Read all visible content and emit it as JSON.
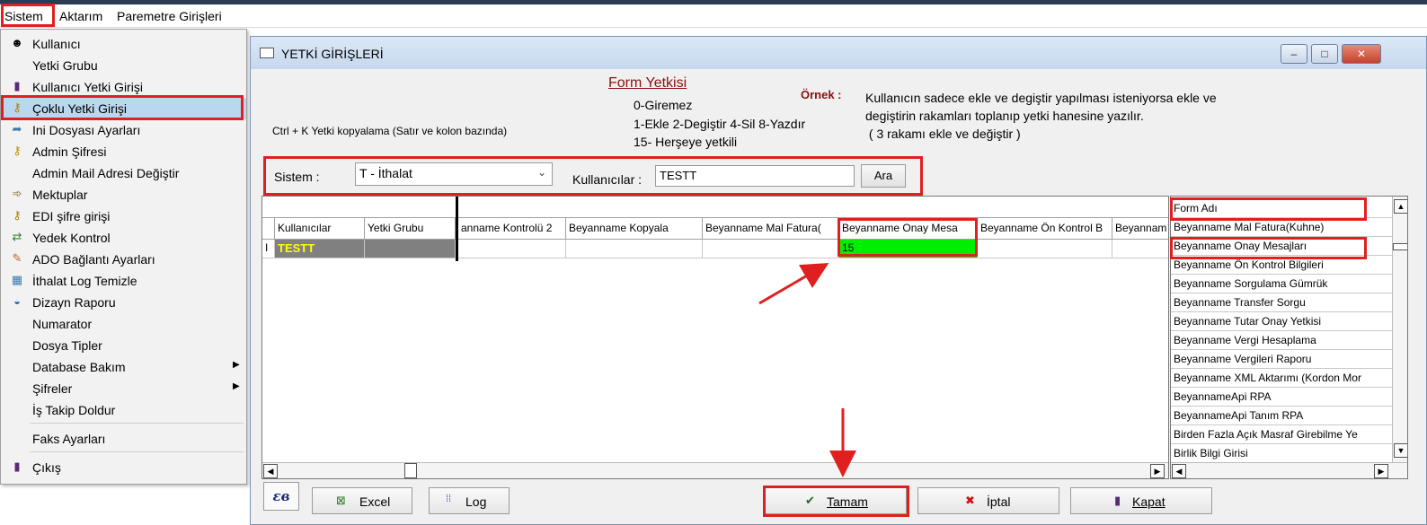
{
  "menubar": {
    "items": [
      "Sistem",
      "Aktarım",
      "Paremetre Girişleri"
    ]
  },
  "sistem_menu": {
    "items": [
      {
        "label": "Kullanıcı",
        "icon": "user-icon"
      },
      {
        "label": "Yetki Grubu",
        "icon": ""
      },
      {
        "label": "Kullanıcı Yetki Girişi",
        "icon": "person-icon"
      },
      {
        "label": "Çoklu Yetki Girişi",
        "icon": "key-icon"
      },
      {
        "label": "Ini Dosyası  Ayarları",
        "icon": "file-arrow-icon"
      },
      {
        "label": "Admin Şifresi",
        "icon": "key-icon"
      },
      {
        "label": "Admin Mail Adresi Değiştir",
        "icon": ""
      },
      {
        "label": "Mektuplar",
        "icon": "arrow-icon"
      },
      {
        "label": "EDI şifre girişi",
        "icon": "key-icon"
      },
      {
        "label": "Yedek Kontrol",
        "icon": "backup-icon"
      },
      {
        "label": "ADO Bağlantı Ayarları",
        "icon": "plug-icon"
      },
      {
        "label": "İthalat Log Temizle",
        "icon": "broom-icon"
      },
      {
        "label": "Dizayn Raporu",
        "icon": "report-icon"
      },
      {
        "label": "Numarator",
        "icon": ""
      },
      {
        "label": "Dosya Tipler",
        "icon": ""
      },
      {
        "label": "Database Bakım",
        "icon": ""
      },
      {
        "label": "Şifreler",
        "icon": ""
      },
      {
        "label": "İş Takip Doldur",
        "icon": ""
      },
      {
        "label": "Faks Ayarları",
        "icon": ""
      },
      {
        "label": "Çıkış",
        "icon": "exit-icon"
      }
    ],
    "selected": "Çoklu Yetki Girişi"
  },
  "window": {
    "title": "YETKİ GİRİŞLERİ",
    "controls": {
      "minimize": "–",
      "maximize": "□",
      "close": "✕"
    }
  },
  "info": {
    "form_title": "Form Yetkisi",
    "codes": [
      "0-Giremez",
      "1-Ekle  2-Degiştir  4-Sil  8-Yazdır",
      "15- Herşeye yetkili"
    ],
    "ornek_label": "Örnek :",
    "ornek_text": [
      "Kullanıcın sadece ekle ve degiştir yapılması isteniyorsa  ekle ve",
      "degiştirin rakamları toplanıp yetki hanesine yazılır.",
      " ( 3 rakamı ekle ve değiştir )"
    ],
    "ctrl_note": "Ctrl + K Yetki kopyalama (Satır ve kolon bazında)"
  },
  "filter": {
    "sistem_label": "Sistem :",
    "sistem_value": "T - İthalat",
    "kullanicilar_label": "Kullanıcılar :",
    "kullanicilar_value": "TESTT",
    "ara_label": "Ara"
  },
  "grid": {
    "fixed_headers": [
      "Kullanıcılar",
      "Yetki Grubu"
    ],
    "headers": [
      "anname Kontrolü 2",
      "Beyanname Kopyala",
      "Beyanname Mal Fatura(",
      "Beyanname Onay Mesa",
      "Beyanname Ön Kontrol B",
      "Beyannam"
    ],
    "row": {
      "user": "TESTT",
      "grup": "",
      "row_marker": "I",
      "values": [
        "",
        "",
        "",
        "15",
        "",
        ""
      ]
    }
  },
  "right_list": {
    "header": "Form Adı",
    "items": [
      "Beyanname Mal Fatura(Kuhne)",
      "Beyanname Onay Mesajları",
      "Beyanname Ön Kontrol Bilgileri",
      "Beyanname Sorgulama Gümrük",
      "Beyanname Transfer Sorgu",
      "Beyanname Tutar Onay Yetkisi",
      "Beyanname Vergi Hesaplama",
      "Beyanname Vergileri Raporu",
      "Beyanname XML Aktarımı (Kordon Mor",
      "BeyannameApi RPA",
      "BeyannameApi Tanım RPA",
      "Birden Fazla Açık Masraf Girebilme Ye",
      "Birlik Bilgi Girisi"
    ]
  },
  "buttons": {
    "logo": "εв",
    "excel": "Excel",
    "log": "Log",
    "tamam": "Tamam",
    "iptal": "İptal",
    "kapat": "Kapat"
  },
  "colors": {
    "highlight_red": "#e02020",
    "green_cell": "#00ee00",
    "menu_selected": "#b9d7f0",
    "dark_cell": "#808080",
    "yellow_text": "#ffff00"
  }
}
